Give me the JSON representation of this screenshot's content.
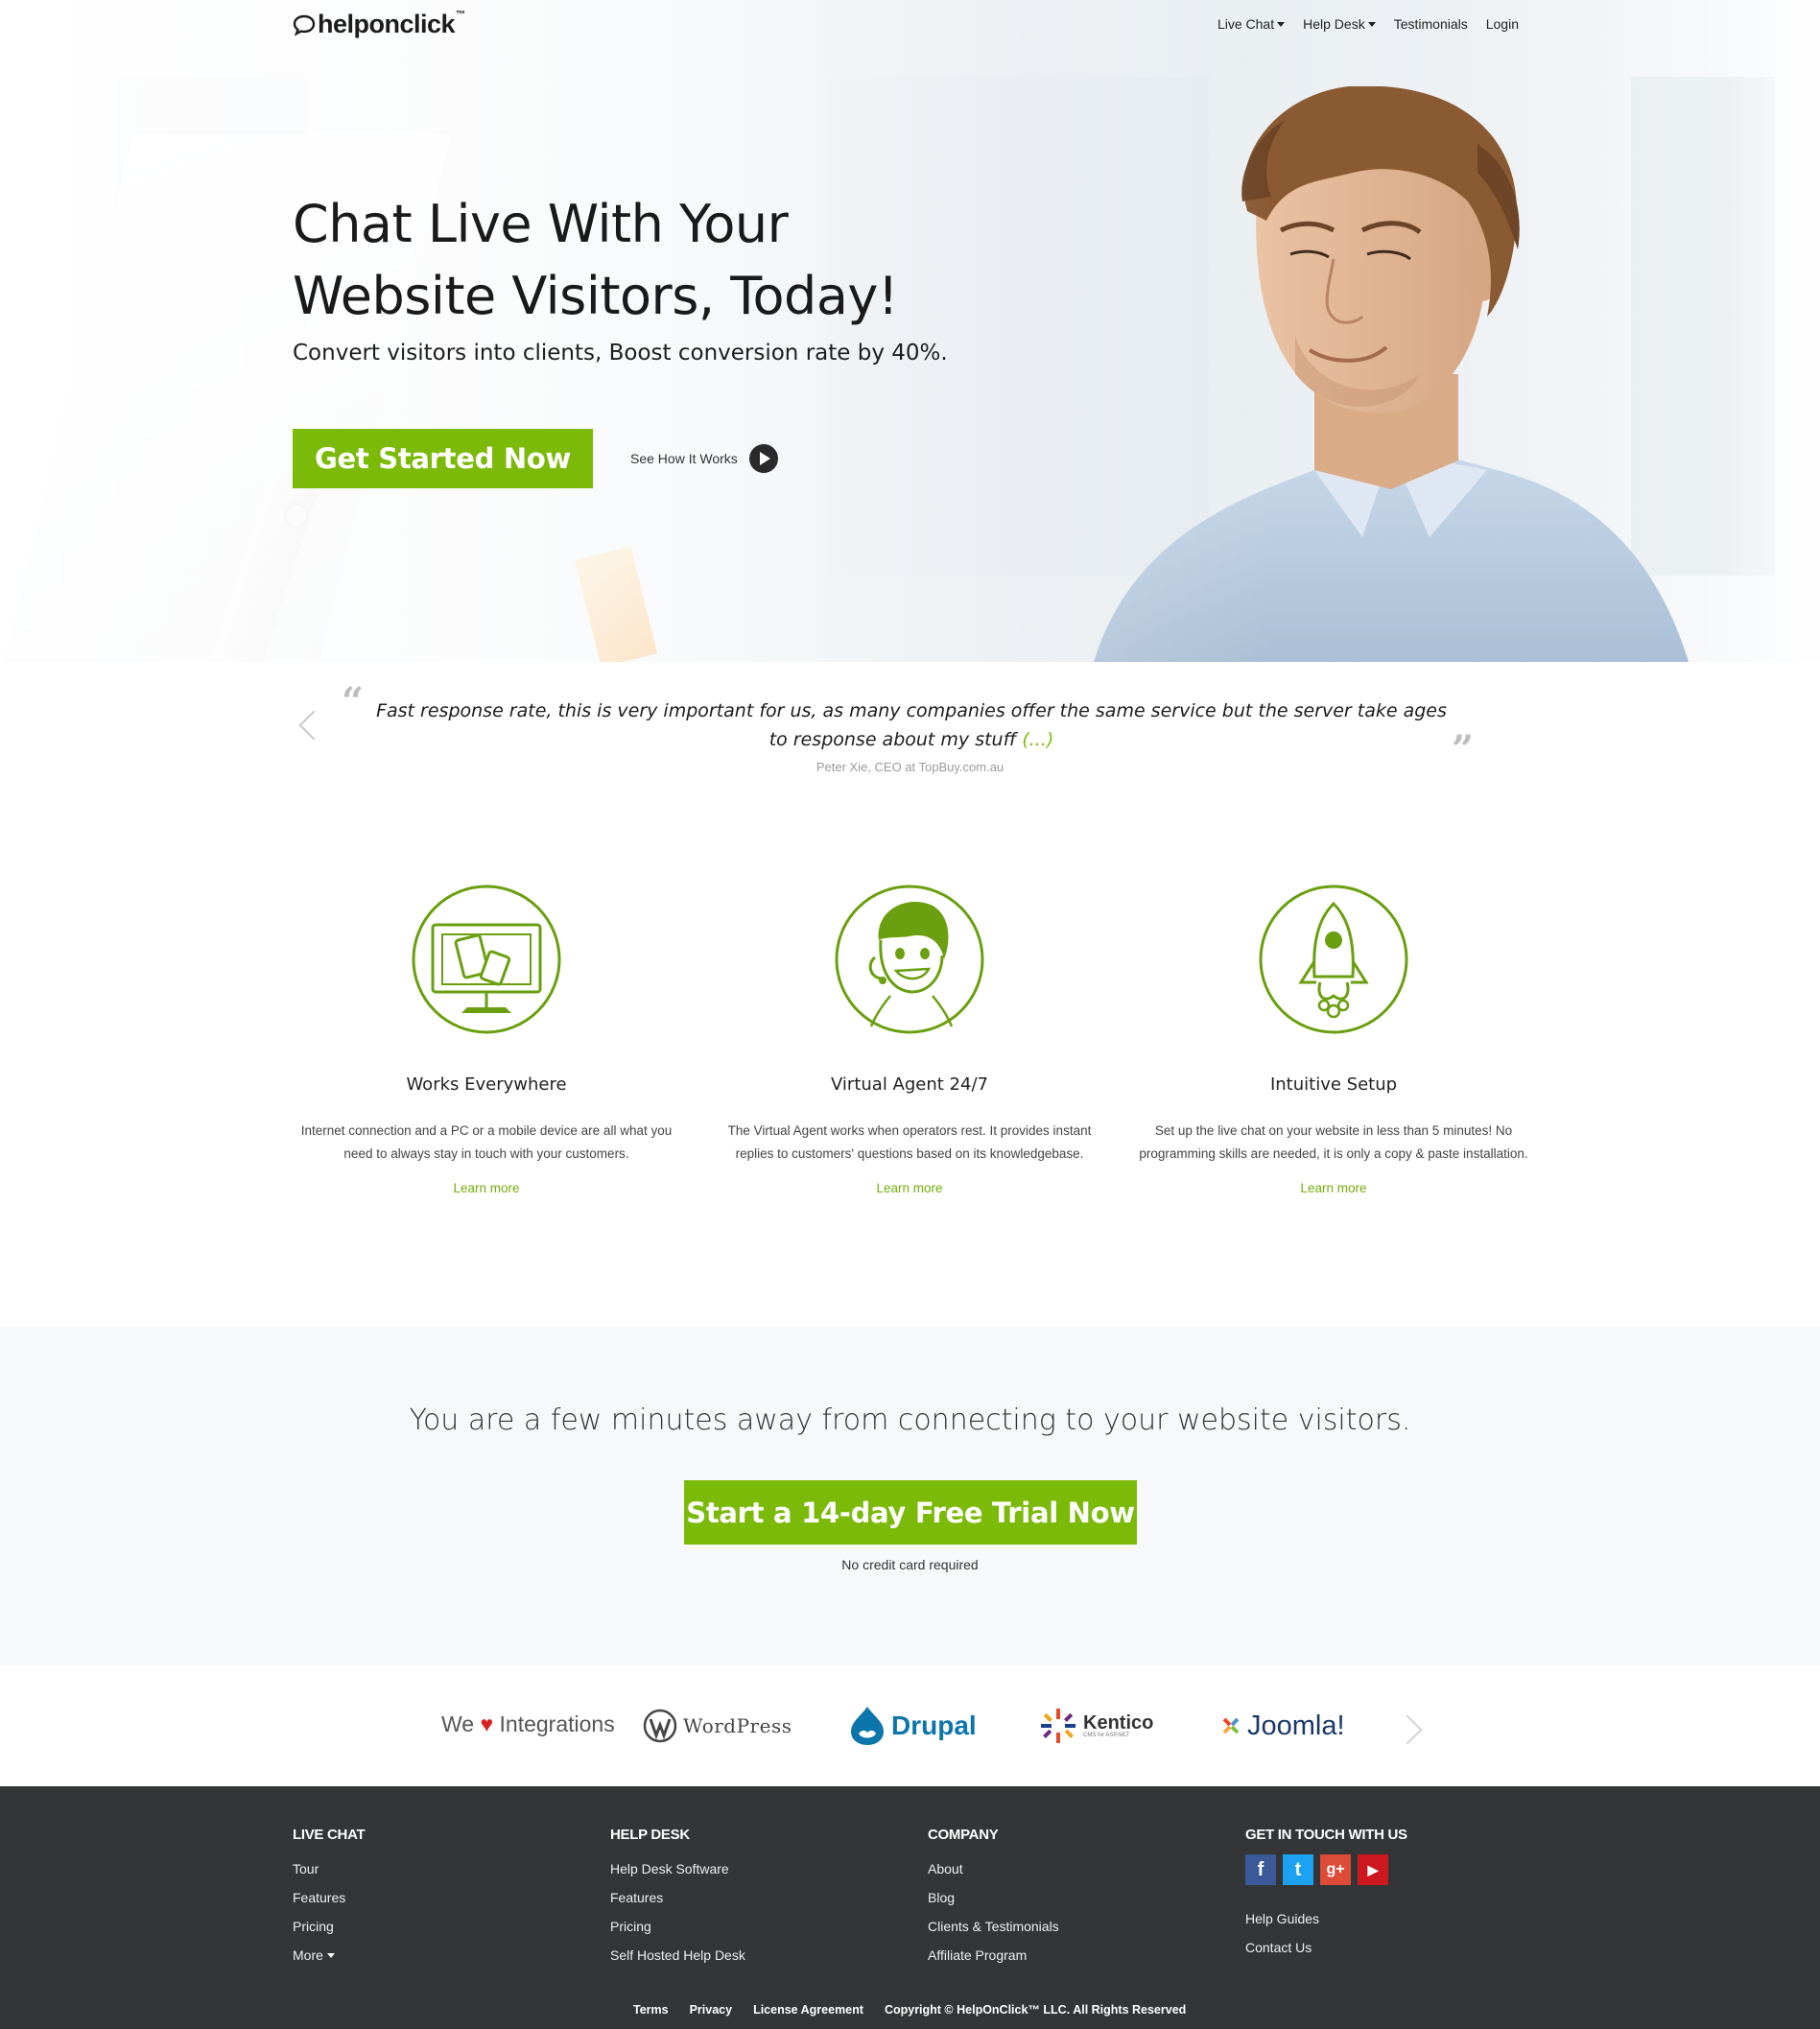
{
  "nav": {
    "logo": "helponclick",
    "logo_tm": "™",
    "items": [
      {
        "label": "Live Chat",
        "dropdown": true
      },
      {
        "label": "Help Desk",
        "dropdown": true
      },
      {
        "label": "Testimonials",
        "dropdown": false
      },
      {
        "label": "Login",
        "dropdown": false
      }
    ]
  },
  "hero": {
    "title_line1": "Chat Live With Your",
    "title_line2": "Website Visitors, Today!",
    "subtitle": "Convert visitors into clients, Boost conversion rate by 40%.",
    "cta": "Get Started Now",
    "see_how": "See How It Works"
  },
  "testimonial": {
    "quote": "Fast response rate, this is very important for us, as many companies offer the same service but the server take ages to response about my stuff",
    "more": "(...)",
    "author": "Peter Xie, CEO at TopBuy.com.au"
  },
  "features": [
    {
      "icon": "devices-monitor-icon",
      "title": "Works Everywhere",
      "desc": "Internet connection and a PC or a mobile device are all what you need to always stay in touch with your customers.",
      "link": "Learn more"
    },
    {
      "icon": "virtual-agent-icon",
      "title": "Virtual Agent 24/7",
      "desc": "The Virtual Agent works when operators rest. It provides instant replies to customers' questions based on its knowledgebase.",
      "link": "Learn more"
    },
    {
      "icon": "rocket-icon",
      "title": "Intuitive Setup",
      "desc": "Set up the live chat on your website in less than 5 minutes! No programming skills are needed, it is only a copy & paste installation.",
      "link": "Learn more"
    }
  ],
  "cta_band": {
    "heading": "You are a few minutes away from connecting to your website visitors.",
    "button": "Start a 14-day Free Trial Now",
    "note": "No credit card required"
  },
  "integrations": {
    "we": "We",
    "heart": "♥",
    "label": "Integrations",
    "logos": [
      "WordPress",
      "Drupal",
      "Kentico",
      "Joomla!"
    ],
    "kentico_tagline": "CMS for ASP.NET"
  },
  "footer": {
    "columns": [
      {
        "heading": "LIVE CHAT",
        "links": [
          "Tour",
          "Features",
          "Pricing",
          "More"
        ]
      },
      {
        "heading": "HELP DESK",
        "links": [
          "Help Desk Software",
          "Features",
          "Pricing",
          "Self Hosted Help Desk"
        ]
      },
      {
        "heading": "COMPANY",
        "links": [
          "About",
          "Blog",
          "Clients & Testimonials",
          "Affiliate Program"
        ]
      },
      {
        "heading": "GET IN TOUCH WITH US",
        "links": [
          "Help Guides",
          "Contact Us"
        ]
      }
    ],
    "socials": [
      "facebook",
      "twitter",
      "google-plus",
      "youtube"
    ],
    "social_glyphs": {
      "facebook": "f",
      "twitter": "t",
      "google_plus": "g+",
      "youtube": "▶"
    },
    "bottom": [
      "Terms",
      "Privacy",
      "License Agreement",
      "Copyright © HelpOnClick™ LLC. All Rights Reserved"
    ]
  },
  "colors": {
    "accent": "#7cba0a",
    "footer_bg": "#333536",
    "cta_band_bg": "#f7f8fa",
    "facebook": "#3b5998",
    "twitter": "#1da1f2",
    "google_plus": "#dd4b39",
    "youtube": "#cc181e"
  }
}
